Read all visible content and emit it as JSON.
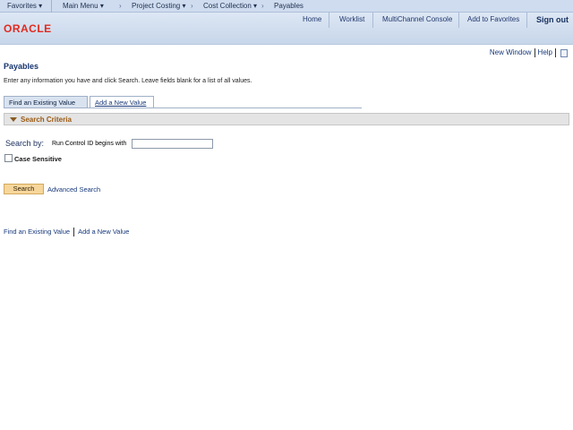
{
  "topnav": {
    "favorites": "Favorites",
    "main_menu": "Main Menu",
    "crumbs": [
      "Project Costing",
      "Cost Collection",
      "Payables"
    ]
  },
  "header": {
    "logo_text": "ORACLE",
    "links": [
      "Home",
      "Worklist",
      "MultiChannel Console",
      "Add to Favorites"
    ],
    "signout": "Sign out"
  },
  "page_links": {
    "new_window": "New Window",
    "help": "Help"
  },
  "page_title": "Payables",
  "instructions": "Enter any information you have and click Search. Leave fields blank for a list of all values.",
  "tabs": {
    "find": "Find an Existing Value",
    "add": "Add a New Value"
  },
  "search_criteria": {
    "title": "Search Criteria",
    "search_by_label": "Search by:",
    "field_label": "Run Control ID begins with",
    "field_value": "",
    "case_sensitive_label": "Case Sensitive",
    "case_sensitive_checked": false
  },
  "buttons": {
    "search": "Search",
    "advanced_search": "Advanced Search"
  },
  "bottom_links": {
    "find": "Find an Existing Value",
    "add": "Add a New Value"
  },
  "colors": {
    "brand_red": "#e02a1e",
    "nav_bg": "#cfdcef",
    "link_blue": "#17397b",
    "search_button": "#f7d69b"
  }
}
